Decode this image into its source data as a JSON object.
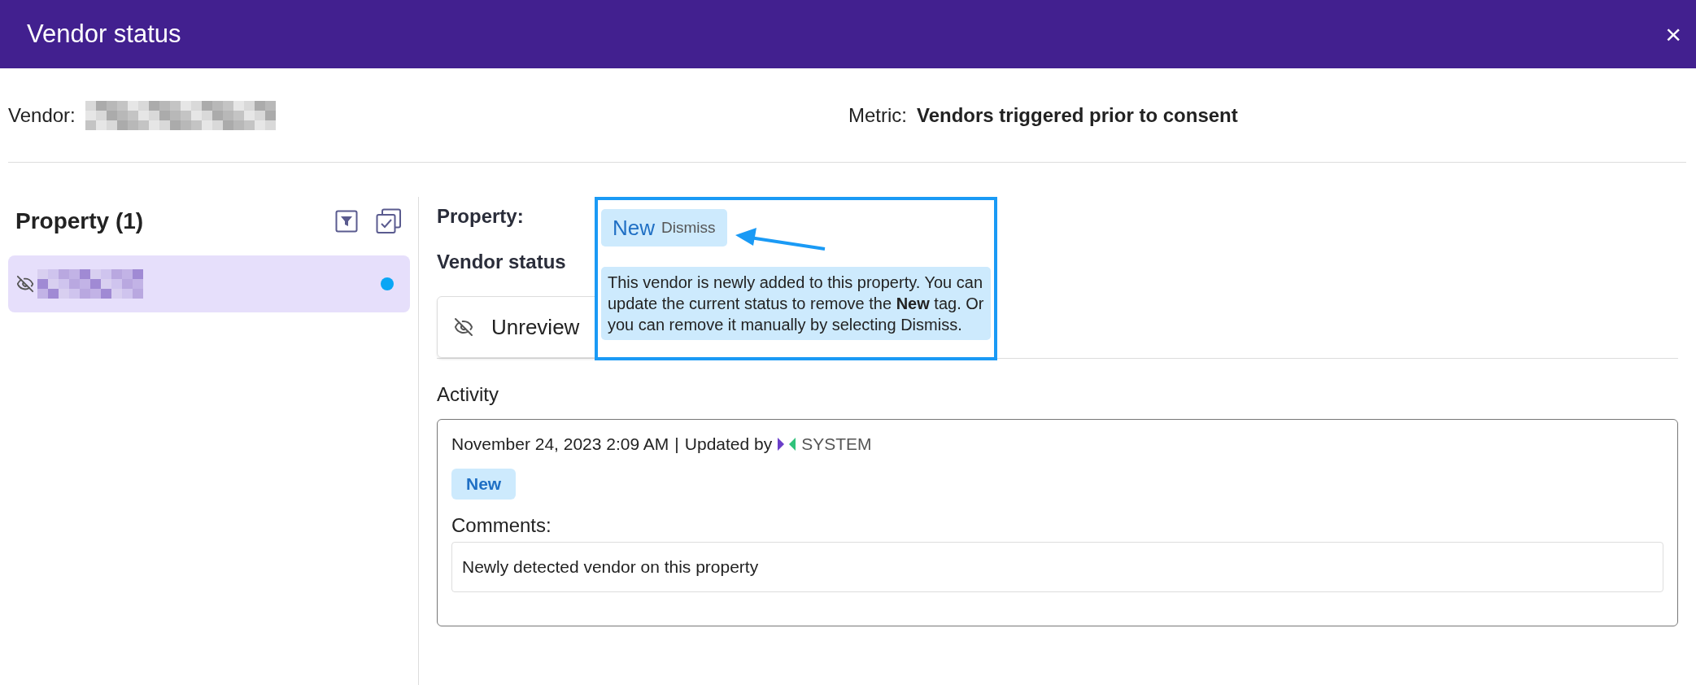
{
  "window": {
    "title": "Vendor status",
    "close": "×"
  },
  "vendor": {
    "label": "Vendor:"
  },
  "metric": {
    "label": "Metric:",
    "value": "Vendors triggered prior to consent"
  },
  "properties": {
    "title": "Property (1)",
    "items": [
      {
        "selected": true,
        "unread": true
      }
    ]
  },
  "detail": {
    "property_label": "Property:",
    "status_label": "Vendor status",
    "status_value": "Unreview"
  },
  "callout": {
    "tag": "New",
    "dismiss": "Dismiss",
    "text": "This vendor is newly added to this property. You can update the current status to remove the **New** tag. Or you can remove it manually by selecting Dismiss."
  },
  "activity": {
    "title": "Activity",
    "entries": [
      {
        "timestamp": "November 24, 2023 2:09 AM",
        "separator": "|",
        "updated_by": "Updated by",
        "user": "SYSTEM",
        "tag": "New",
        "comments_label": "Comments:",
        "comment": "Newly detected vendor on this property"
      }
    ]
  }
}
